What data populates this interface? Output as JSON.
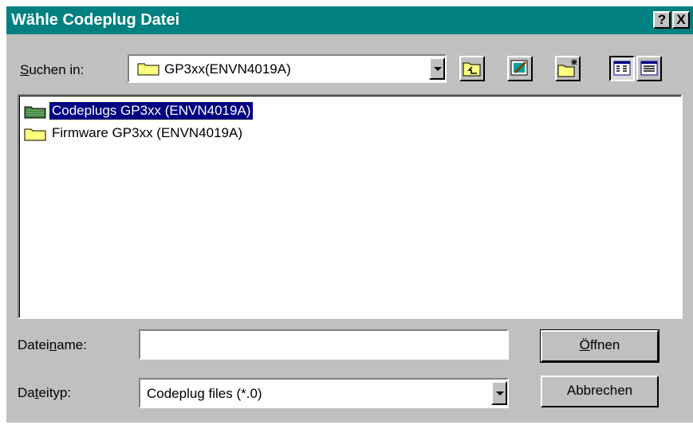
{
  "window": {
    "title": "Wähle Codeplug Datei",
    "help_btn": "?",
    "close_btn": "X"
  },
  "lookin": {
    "label_pre": "S",
    "label_post": "uchen in:",
    "value": "GP3xx(ENVN4019A)"
  },
  "files": [
    {
      "name": "Codeplugs GP3xx (ENVN4019A)",
      "selected": true
    },
    {
      "name": "Firmware GP3xx (ENVN4019A)",
      "selected": false
    }
  ],
  "filename": {
    "label_pre": "Datei",
    "label_u": "n",
    "label_post": "ame:",
    "value": ""
  },
  "filetype": {
    "label_pre": "Da",
    "label_u": "t",
    "label_post": "eityp:",
    "value": "Codeplug files (*.0)"
  },
  "buttons": {
    "open_pre": "",
    "open_u": "Ö",
    "open_post": "ffnen",
    "cancel": "Abbrechen"
  },
  "colors": {
    "titlebar": "#008080",
    "face": "#c0c0c0",
    "selection": "#000080",
    "folder": "#ffff80"
  }
}
